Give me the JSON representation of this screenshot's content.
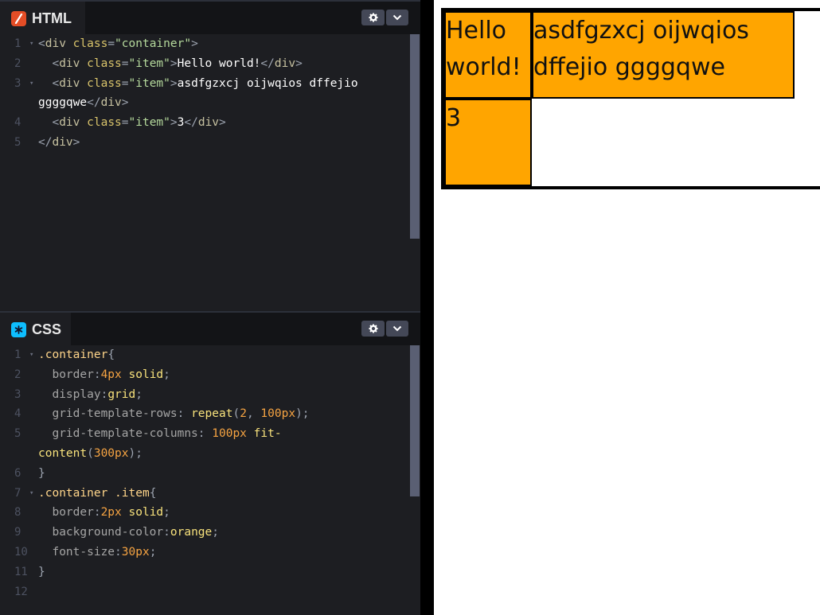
{
  "html_panel": {
    "title": "HTML",
    "icon": "html-logo-icon",
    "line_numbers": [
      "1",
      "2",
      "3",
      "",
      "4",
      "5"
    ],
    "lines": [
      [
        [
          "punct",
          "<"
        ],
        [
          "tag",
          "div "
        ],
        [
          "attr",
          "class"
        ],
        [
          "punct",
          "="
        ],
        [
          "str",
          "\"container\""
        ],
        [
          "punct",
          ">"
        ]
      ],
      [
        [
          "punct",
          "  <"
        ],
        [
          "tag",
          "div "
        ],
        [
          "attr",
          "class"
        ],
        [
          "punct",
          "="
        ],
        [
          "str",
          "\"item\""
        ],
        [
          "punct",
          ">"
        ],
        [
          "text",
          "Hello world!"
        ],
        [
          "punct",
          "</"
        ],
        [
          "tag",
          "div"
        ],
        [
          "punct",
          ">"
        ]
      ],
      [
        [
          "punct",
          "  <"
        ],
        [
          "tag",
          "div "
        ],
        [
          "attr",
          "class"
        ],
        [
          "punct",
          "="
        ],
        [
          "str",
          "\"item\""
        ],
        [
          "punct",
          ">"
        ],
        [
          "text",
          "asdfgzxcj oijwqios dffejio"
        ]
      ],
      [
        [
          "text",
          "ggggqwe"
        ],
        [
          "punct",
          "</"
        ],
        [
          "tag",
          "div"
        ],
        [
          "punct",
          ">"
        ]
      ],
      [
        [
          "punct",
          "  <"
        ],
        [
          "tag",
          "div "
        ],
        [
          "attr",
          "class"
        ],
        [
          "punct",
          "="
        ],
        [
          "str",
          "\"item\""
        ],
        [
          "punct",
          ">"
        ],
        [
          "text",
          "3"
        ],
        [
          "punct",
          "</"
        ],
        [
          "tag",
          "div"
        ],
        [
          "punct",
          ">"
        ]
      ],
      [
        [
          "punct",
          "</"
        ],
        [
          "tag",
          "div"
        ],
        [
          "punct",
          ">"
        ]
      ]
    ]
  },
  "css_panel": {
    "title": "CSS",
    "icon": "css-logo-icon",
    "line_numbers": [
      "1",
      "2",
      "3",
      "4",
      "5",
      "",
      "6",
      "7",
      "8",
      "9",
      "10",
      "11",
      "12"
    ],
    "lines": [
      [
        [
          "sel",
          ".container"
        ],
        [
          "punct",
          "{"
        ]
      ],
      [
        [
          "prop",
          "  border"
        ],
        [
          "punct",
          ":"
        ],
        [
          "num",
          "4px"
        ],
        [
          "val",
          " solid"
        ],
        [
          "punct",
          ";"
        ]
      ],
      [
        [
          "prop",
          "  display"
        ],
        [
          "punct",
          ":"
        ],
        [
          "val",
          "grid"
        ],
        [
          "punct",
          ";"
        ]
      ],
      [
        [
          "prop",
          "  grid-template-rows"
        ],
        [
          "punct",
          ": "
        ],
        [
          "val",
          "repeat"
        ],
        [
          "punct",
          "("
        ],
        [
          "num",
          "2"
        ],
        [
          "punct",
          ", "
        ],
        [
          "num",
          "100px"
        ],
        [
          "punct",
          ");"
        ]
      ],
      [
        [
          "prop",
          "  grid-template-columns"
        ],
        [
          "punct",
          ": "
        ],
        [
          "num",
          "100px"
        ],
        [
          "val",
          " fit-"
        ]
      ],
      [
        [
          "val",
          "content"
        ],
        [
          "punct",
          "("
        ],
        [
          "num",
          "300px"
        ],
        [
          "punct",
          ");"
        ]
      ],
      [
        [
          "punct",
          "}"
        ]
      ],
      [
        [
          "sel",
          ".container .item"
        ],
        [
          "punct",
          "{"
        ]
      ],
      [
        [
          "prop",
          "  border"
        ],
        [
          "punct",
          ":"
        ],
        [
          "num",
          "2px"
        ],
        [
          "val",
          " solid"
        ],
        [
          "punct",
          ";"
        ]
      ],
      [
        [
          "prop",
          "  background-color"
        ],
        [
          "punct",
          ":"
        ],
        [
          "val",
          "orange"
        ],
        [
          "punct",
          ";"
        ]
      ],
      [
        [
          "prop",
          "  font-size"
        ],
        [
          "punct",
          ":"
        ],
        [
          "num",
          "30px"
        ],
        [
          "punct",
          ";"
        ]
      ],
      [
        [
          "punct",
          "}"
        ]
      ],
      []
    ]
  },
  "preview": {
    "items": [
      "Hello world!",
      "asdfgzxcj oijwqios dffejio ggggqwe",
      "3"
    ]
  },
  "colors": {
    "item_bg": "#ffa500",
    "editor_bg": "#1d1e22",
    "header_bg": "#131417"
  }
}
